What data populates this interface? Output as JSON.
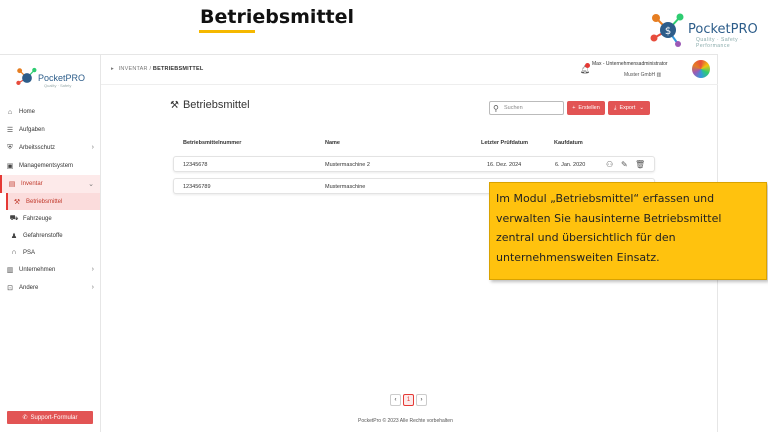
{
  "slide": {
    "title": "Betriebsmittel",
    "brand": "PocketPRO",
    "brand_tag": "Quality · Safety · Performance"
  },
  "sidebar": {
    "logo_text": "PocketPRO",
    "logo_tag": "Quality · Safety",
    "items": [
      {
        "label": "Home",
        "icon": "home-icon"
      },
      {
        "label": "Aufgaben",
        "icon": "list-icon"
      },
      {
        "label": "Arbeitsschutz",
        "icon": "shield-icon"
      },
      {
        "label": "Managementsystem",
        "icon": "box-icon"
      },
      {
        "label": "Inventar",
        "icon": "inventory-icon"
      },
      {
        "label": "Betriebsmittel",
        "icon": "tools-icon"
      },
      {
        "label": "Fahrzeuge",
        "icon": "car-icon"
      },
      {
        "label": "Gefahrenstoffe",
        "icon": "flask-icon"
      },
      {
        "label": "PSA",
        "icon": "headphones-icon"
      },
      {
        "label": "Unternehmen",
        "icon": "building-icon"
      },
      {
        "label": "Andere",
        "icon": "other-icon"
      }
    ],
    "support_label": "Support-Formular"
  },
  "topbar": {
    "breadcrumb_root": "INVENTAR",
    "breadcrumb_sep": "/",
    "breadcrumb_current": "BETRIEBSMITTEL",
    "user_name": "Max - Unternehmensadministrator",
    "company": "Muster GmbH"
  },
  "main": {
    "title": "Betriebsmittel",
    "search_placeholder": "Suchen",
    "create_label": "Erstellen",
    "export_label": "Export",
    "columns": [
      "Betriebsmittelnummer",
      "Name",
      "Letzter Prüfdatum",
      "Kaufdatum"
    ],
    "rows": [
      {
        "number": "12345678",
        "name": "Mustermaschine 2",
        "last_check": "16. Dez. 2024",
        "purchase": "6. Jan. 2020"
      },
      {
        "number": "123456789",
        "name": "Mustermaschine",
        "last_check": "",
        "purchase": ""
      }
    ],
    "pager": {
      "prev": "‹",
      "current": "1",
      "next": "›"
    },
    "footer": "PocketPro © 2023 Alle Rechte vorbehalten"
  },
  "callout": {
    "text": "Im Modul „Betriebsmittel“ erfassen und verwalten Sie hausinterne Betriebsmittel zentral und übersichtlich für den unternehmensweiten Einsatz."
  },
  "colors": {
    "accent": "#e25454",
    "highlight": "#ffc20e",
    "brand": "#2d5d8a"
  }
}
